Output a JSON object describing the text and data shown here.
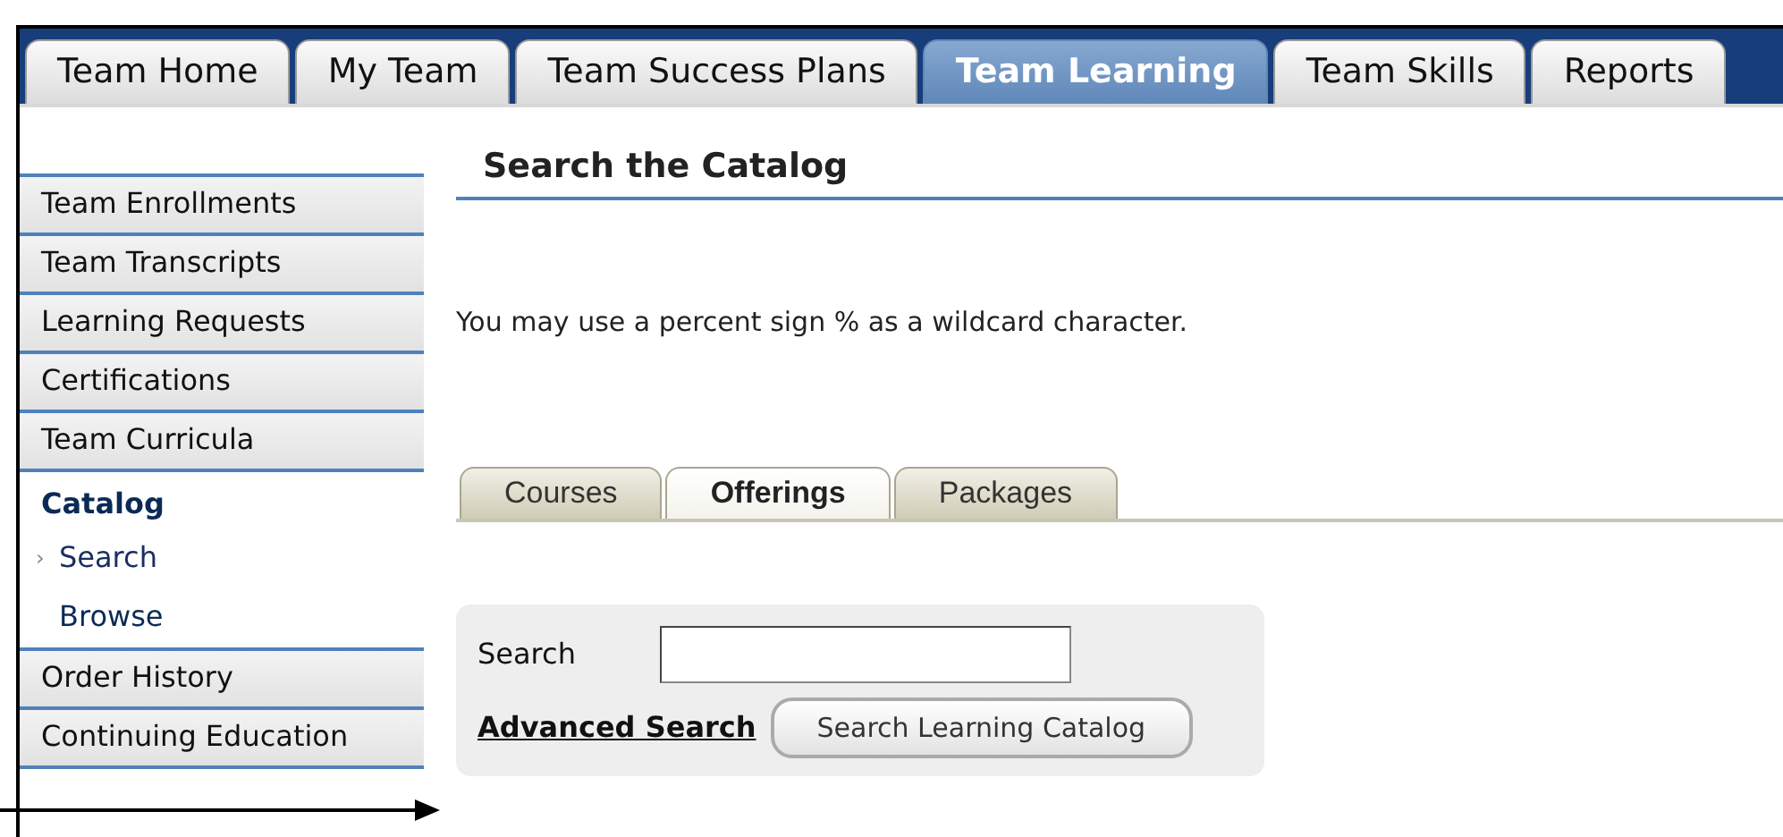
{
  "top_tabs": [
    {
      "label": "Team Home",
      "selected": false
    },
    {
      "label": "My Team",
      "selected": false
    },
    {
      "label": "Team Success Plans",
      "selected": false
    },
    {
      "label": "Team Learning",
      "selected": true
    },
    {
      "label": "Team Skills",
      "selected": false
    },
    {
      "label": "Reports",
      "selected": false
    }
  ],
  "sidebar": {
    "items": [
      {
        "label": "Team Enrollments",
        "kind": "link"
      },
      {
        "label": "Team Transcripts",
        "kind": "link"
      },
      {
        "label": "Learning Requests",
        "kind": "link"
      },
      {
        "label": "Certifications",
        "kind": "link"
      },
      {
        "label": "Team Curricula",
        "kind": "link"
      },
      {
        "label": "Catalog",
        "kind": "heading",
        "children": [
          {
            "label": "Search",
            "marker": "›",
            "selected": true
          },
          {
            "label": "Browse",
            "selected": false
          }
        ]
      },
      {
        "label": "Order History",
        "kind": "link"
      },
      {
        "label": "Continuing Education",
        "kind": "link"
      }
    ]
  },
  "page_title": "Search the Catalog",
  "hint": "You may use a percent sign % as a wildcard character.",
  "search_tabs": [
    {
      "label": "Courses",
      "selected": false
    },
    {
      "label": "Offerings",
      "selected": true
    },
    {
      "label": "Packages",
      "selected": false
    }
  ],
  "search_form": {
    "label": "Search",
    "advanced_link": "Advanced Search",
    "submit_button": "Search Learning Catalog"
  }
}
